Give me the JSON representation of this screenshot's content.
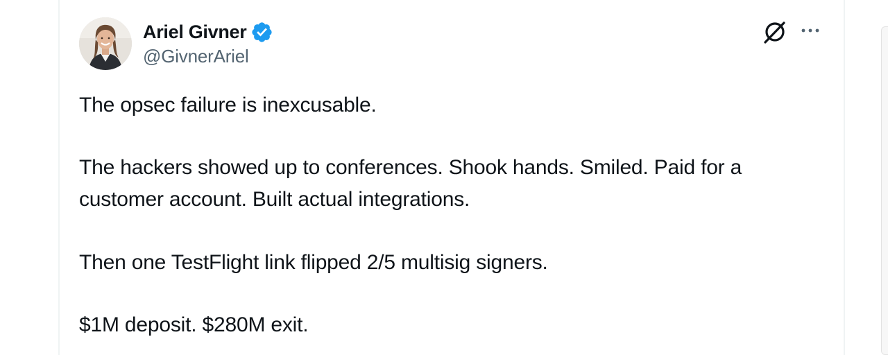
{
  "author": {
    "display_name": "Ariel Givner",
    "handle": "@GivnerAriel",
    "verified_badge_icon": "verified-badge-icon",
    "avatar_icon": "profile-photo"
  },
  "actions": {
    "grok_icon": "grok-icon",
    "more_icon": "more-options-icon"
  },
  "tweet": {
    "paragraph_1": "The opsec failure is inexcusable.",
    "paragraph_2_line_1": "The hackers showed up to conferences. Shook hands. Smiled. Paid for a",
    "paragraph_2_line_2": "customer account. Built actual integrations.",
    "paragraph_3": "Then one TestFlight link flipped 2/5 multisig signers.",
    "paragraph_4": "$1M deposit. $280M exit."
  },
  "colors": {
    "text_primary": "#0f1419",
    "text_secondary": "#536471",
    "verified_blue": "#1d9bf0",
    "border": "#eff3f4"
  }
}
